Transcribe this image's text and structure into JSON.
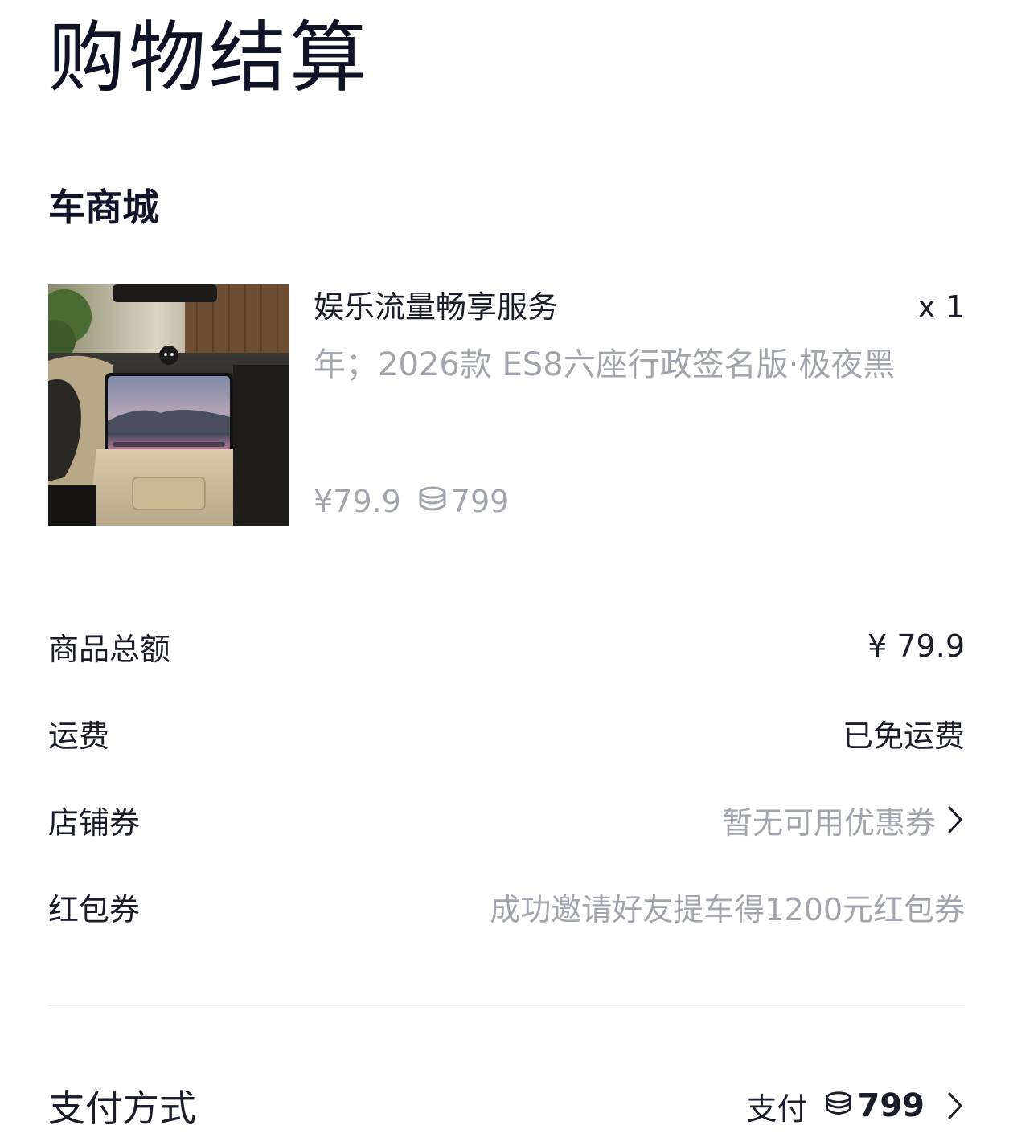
{
  "header": {
    "title": "购物结算"
  },
  "store": {
    "name": "车商城"
  },
  "product": {
    "name": "娱乐流量畅享服务",
    "quantity": "x 1",
    "variant": "年；2026款 ES8六座行政签名版·极夜黑",
    "price": "¥79.9",
    "points": "799",
    "image_icon": "car-interior-image"
  },
  "summary": {
    "subtotal_label": "商品总额",
    "subtotal_value": "¥ 79.9",
    "shipping_label": "运费",
    "shipping_value": "已免运费",
    "store_coupon_label": "店铺券",
    "store_coupon_value": "暂无可用优惠券",
    "red_packet_label": "红包券",
    "red_packet_value": "成功邀请好友提车得1200元红包券"
  },
  "payment": {
    "label": "支付方式",
    "prefix": "支付",
    "amount": "799"
  },
  "colors": {
    "primary_text": "#1b1d2a",
    "muted_text": "#a2a5ae",
    "divider": "#e9eaee",
    "background": "#ffffff"
  }
}
